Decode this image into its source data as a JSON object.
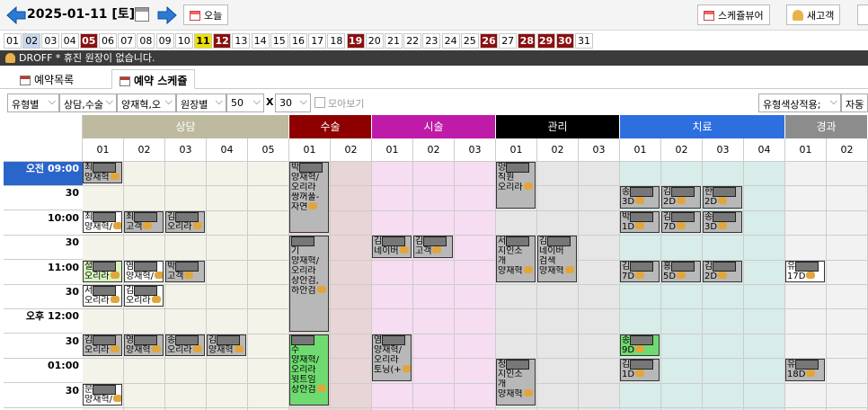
{
  "header": {
    "date": "2025-01-11 [토]",
    "today_label": "오늘",
    "scheduler_label": "스케쥴뷰어",
    "new_client_label": "새고객"
  },
  "days": {
    "selected": "02",
    "saturday": "11",
    "holidays": [
      "05",
      "12",
      "19",
      "26",
      "28",
      "29",
      "30"
    ],
    "labels": [
      "01",
      "02",
      "03",
      "04",
      "05",
      "06",
      "07",
      "08",
      "09",
      "10",
      "11",
      "12",
      "13",
      "14",
      "15",
      "16",
      "17",
      "18",
      "19",
      "20",
      "21",
      "22",
      "23",
      "24",
      "25",
      "26",
      "27",
      "28",
      "29",
      "30",
      "31"
    ]
  },
  "status": {
    "text": "DROFF  * 휴진 원장이 없습니다."
  },
  "tabs": [
    {
      "label": "예약목록"
    },
    {
      "label": "예약 스케쥴"
    }
  ],
  "filters": {
    "type": "유형별",
    "consult": "상담,수술",
    "staff": "양재혁,오",
    "director": "원장별",
    "interval": "50",
    "x_label": "X",
    "count": "30",
    "view_all": "모아보기",
    "color": "유형색상적용;",
    "auto": "자동"
  },
  "groups": [
    {
      "name": "상담",
      "color": "#bdbaa0",
      "cols": [
        "01",
        "02",
        "03",
        "04",
        "05"
      ]
    },
    {
      "name": "수술",
      "color": "#8e0000",
      "cols": [
        "01",
        "02"
      ]
    },
    {
      "name": "시술",
      "color": "#bf1aa8",
      "cols": [
        "01",
        "02",
        "03"
      ]
    },
    {
      "name": "관리",
      "color": "#000000",
      "cols": [
        "01",
        "02",
        "03"
      ]
    },
    {
      "name": "치료",
      "color": "#2e6fe0",
      "cols": [
        "01",
        "02",
        "03",
        "04"
      ]
    },
    {
      "name": "경과",
      "color": "#8c8c8c",
      "cols": [
        "01",
        "02"
      ]
    }
  ],
  "times": [
    "오전 09:00",
    "30",
    "10:00",
    "30",
    "11:00",
    "30",
    "오후 12:00",
    "30",
    "01:00",
    "30"
  ],
  "appointments": [
    {
      "col": 0,
      "row": 0,
      "rows": 1,
      "lines": [
        "최",
        "양재혁"
      ],
      "style": "gray"
    },
    {
      "col": 0,
      "row": 2,
      "rows": 1,
      "lines": [
        "최",
        "양재혁/"
      ],
      "style": "white"
    },
    {
      "col": 1,
      "row": 2,
      "rows": 1,
      "lines": [
        "최",
        "고객"
      ],
      "style": "gray"
    },
    {
      "col": 2,
      "row": 2,
      "rows": 1,
      "lines": [
        "김",
        "오리라"
      ],
      "style": "gray"
    },
    {
      "col": 0,
      "row": 4,
      "rows": 1,
      "lines": [
        "설",
        "오리라"
      ],
      "style": "light"
    },
    {
      "col": 1,
      "row": 4,
      "rows": 1,
      "lines": [
        "염",
        "양재혁/"
      ],
      "style": "white"
    },
    {
      "col": 2,
      "row": 4,
      "rows": 1,
      "lines": [
        "박",
        "고객"
      ],
      "style": "gray"
    },
    {
      "col": 0,
      "row": 5,
      "rows": 1,
      "lines": [
        "서",
        "오리라"
      ],
      "style": "white"
    },
    {
      "col": 1,
      "row": 5,
      "rows": 1,
      "lines": [
        "김",
        "오리라"
      ],
      "style": "white"
    },
    {
      "col": 0,
      "row": 7,
      "rows": 1,
      "lines": [
        "김",
        "오리라"
      ],
      "style": "gray"
    },
    {
      "col": 1,
      "row": 7,
      "rows": 1,
      "lines": [
        "영",
        "양재혁"
      ],
      "style": "gray"
    },
    {
      "col": 2,
      "row": 7,
      "rows": 1,
      "lines": [
        "송",
        "오리라"
      ],
      "style": "gray"
    },
    {
      "col": 3,
      "row": 7,
      "rows": 1,
      "lines": [
        "김",
        "양재혁"
      ],
      "style": "gray"
    },
    {
      "col": 0,
      "row": 9,
      "rows": 1,
      "lines": [
        "문",
        "양재혁/"
      ],
      "style": "white"
    },
    {
      "col": 5,
      "row": 0,
      "rows": 3,
      "lines": [
        "박",
        "",
        "양재혁/",
        "오리라",
        "쌍꺼풀-",
        "자연"
      ],
      "style": "gray"
    },
    {
      "col": 5,
      "row": 3,
      "rows": 4,
      "lines": [
        "",
        "기",
        "양재혁/",
        "오리라",
        "상안검,",
        "하안검"
      ],
      "style": "gray"
    },
    {
      "col": 5,
      "row": 7,
      "rows": 3,
      "lines": [
        "",
        "수",
        "양재혁/",
        "오리라",
        "윗트임",
        "상안검"
      ],
      "style": "green"
    },
    {
      "col": 7,
      "row": 3,
      "rows": 1,
      "lines": [
        "김",
        "네이버"
      ],
      "style": "gray"
    },
    {
      "col": 8,
      "row": 3,
      "rows": 1,
      "lines": [
        "김",
        "고객"
      ],
      "style": "gray"
    },
    {
      "col": 7,
      "row": 7,
      "rows": 2,
      "lines": [
        "염",
        "양재혁/",
        "오리라",
        "토닝(+"
      ],
      "style": "gray"
    },
    {
      "col": 10,
      "row": 0,
      "rows": 2,
      "lines": [
        "양",
        "직원",
        "오리라"
      ],
      "style": "gray"
    },
    {
      "col": 10,
      "row": 3,
      "rows": 2,
      "lines": [
        "서",
        "지인소",
        "개",
        "양재혁"
      ],
      "style": "gray"
    },
    {
      "col": 11,
      "row": 3,
      "rows": 2,
      "lines": [
        "김",
        "네이버",
        "검색",
        "양재혁"
      ],
      "style": "gray"
    },
    {
      "col": 10,
      "row": 8,
      "rows": 2,
      "lines": [
        "정",
        "지인소",
        "개",
        "양재혁"
      ],
      "style": "gray"
    },
    {
      "col": 13,
      "row": 1,
      "rows": 1,
      "lines": [
        "송",
        "3D"
      ],
      "style": "gray"
    },
    {
      "col": 14,
      "row": 1,
      "rows": 1,
      "lines": [
        "김",
        "2D"
      ],
      "style": "gray"
    },
    {
      "col": 15,
      "row": 1,
      "rows": 1,
      "lines": [
        "한",
        "2D"
      ],
      "style": "gray"
    },
    {
      "col": 13,
      "row": 2,
      "rows": 1,
      "lines": [
        "박",
        "1D"
      ],
      "style": "gray"
    },
    {
      "col": 14,
      "row": 2,
      "rows": 1,
      "lines": [
        "김",
        "7D"
      ],
      "style": "gray"
    },
    {
      "col": 15,
      "row": 2,
      "rows": 1,
      "lines": [
        "송",
        "3D"
      ],
      "style": "gray"
    },
    {
      "col": 13,
      "row": 4,
      "rows": 1,
      "lines": [
        "김",
        "7D"
      ],
      "style": "gray"
    },
    {
      "col": 14,
      "row": 4,
      "rows": 1,
      "lines": [
        "홍",
        "5D"
      ],
      "style": "gray"
    },
    {
      "col": 15,
      "row": 4,
      "rows": 1,
      "lines": [
        "김",
        "2D"
      ],
      "style": "gray"
    },
    {
      "col": 13,
      "row": 7,
      "rows": 1,
      "lines": [
        "송",
        "9D"
      ],
      "style": "green"
    },
    {
      "col": 13,
      "row": 8,
      "rows": 1,
      "lines": [
        "김",
        "1D"
      ],
      "style": "gray"
    },
    {
      "col": 17,
      "row": 4,
      "rows": 1,
      "lines": [
        "유",
        "17D"
      ],
      "style": "white"
    },
    {
      "col": 17,
      "row": 8,
      "rows": 1,
      "lines": [
        "유",
        "18D"
      ],
      "style": "gray"
    }
  ]
}
